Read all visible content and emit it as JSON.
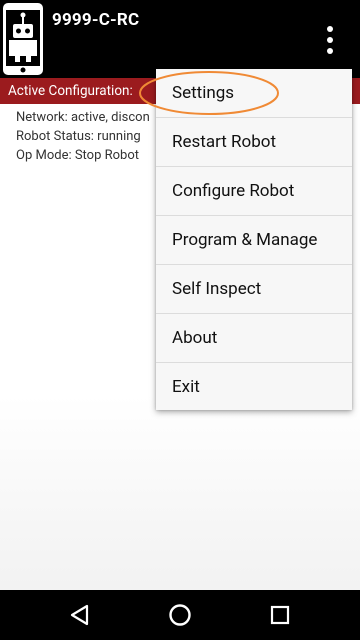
{
  "header": {
    "title": "9999-C-RC",
    "app_icon": "robot-phone-icon",
    "overflow_icon": "more-vert-icon"
  },
  "config_bar": {
    "label": "Active Configuration:",
    "color": "#9b1b1e"
  },
  "status": {
    "network": "Network: active, discon",
    "robot_status": "Robot Status: running",
    "op_mode": "Op Mode: Stop Robot"
  },
  "menu": {
    "items": [
      {
        "label": "Settings"
      },
      {
        "label": "Restart Robot"
      },
      {
        "label": "Configure Robot"
      },
      {
        "label": "Program & Manage"
      },
      {
        "label": "Self Inspect"
      },
      {
        "label": "About"
      },
      {
        "label": "Exit"
      }
    ],
    "highlight_color": "#f08a35"
  },
  "navbar": {
    "back_icon": "back-triangle-icon",
    "home_icon": "home-circle-icon",
    "recents_icon": "recents-square-icon"
  }
}
